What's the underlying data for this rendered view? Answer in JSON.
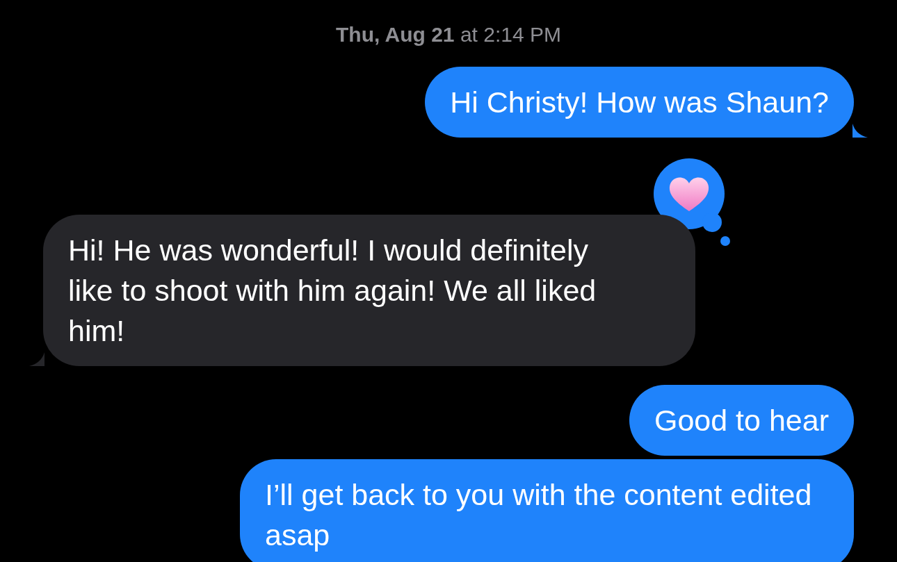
{
  "timestamp": "**Thu, Aug 21** at 2:14 PM",
  "messages": [
    {
      "kind": "sent",
      "text": "Hi Christy! How was Shaun?",
      "tail": true
    },
    {
      "kind": "received",
      "text": "Hi! He was wonderful! I would definitely like to shoot with him again! We all liked him!",
      "tail": true,
      "reaction": {
        "kind": "heart"
      }
    },
    {
      "kind": "sent",
      "text": "Good to hear",
      "tail": false
    },
    {
      "kind": "sent",
      "text": "I’ll get back to you with the content edited asap",
      "tail": false
    }
  ]
}
